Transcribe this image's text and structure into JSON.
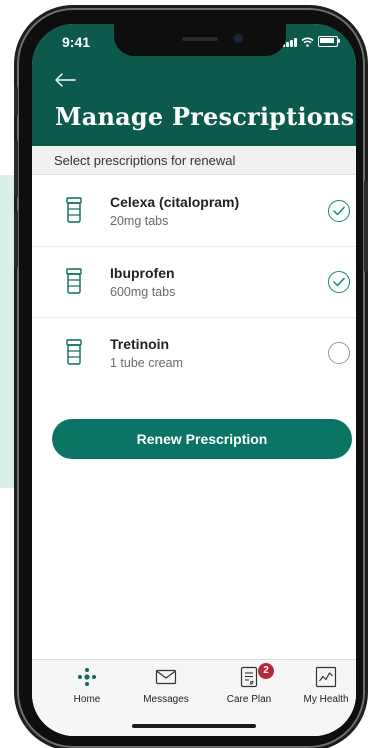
{
  "status_bar": {
    "time": "9:41"
  },
  "header": {
    "title": "Manage Prescriptions"
  },
  "subheader": {
    "text": "Select prescriptions for renewal"
  },
  "prescriptions": [
    {
      "name": "Celexa (citalopram)",
      "detail": "20mg tabs",
      "selected": true
    },
    {
      "name": "Ibuprofen",
      "detail": "600mg tabs",
      "selected": true
    },
    {
      "name": "Tretinoin",
      "detail": "1 tube cream",
      "selected": false
    }
  ],
  "actions": {
    "renew_label": "Renew Prescription"
  },
  "tabbar": {
    "home": "Home",
    "messages": "Messages",
    "care_plan": "Care Plan",
    "care_plan_badge": "2",
    "my_health": "My Health"
  },
  "icons": {
    "back": "arrow-left-icon",
    "prescription": "pill-bottle-icon",
    "check": "check-circle-icon",
    "home": "dots-cluster-icon",
    "messages": "envelope-icon",
    "care_plan": "care-plan-document-icon",
    "my_health": "line-chart-icon"
  },
  "colors": {
    "header_bg": "#0b5a4c",
    "accent": "#0b7565",
    "check": "#0f8a74",
    "badge": "#b52a3b"
  }
}
